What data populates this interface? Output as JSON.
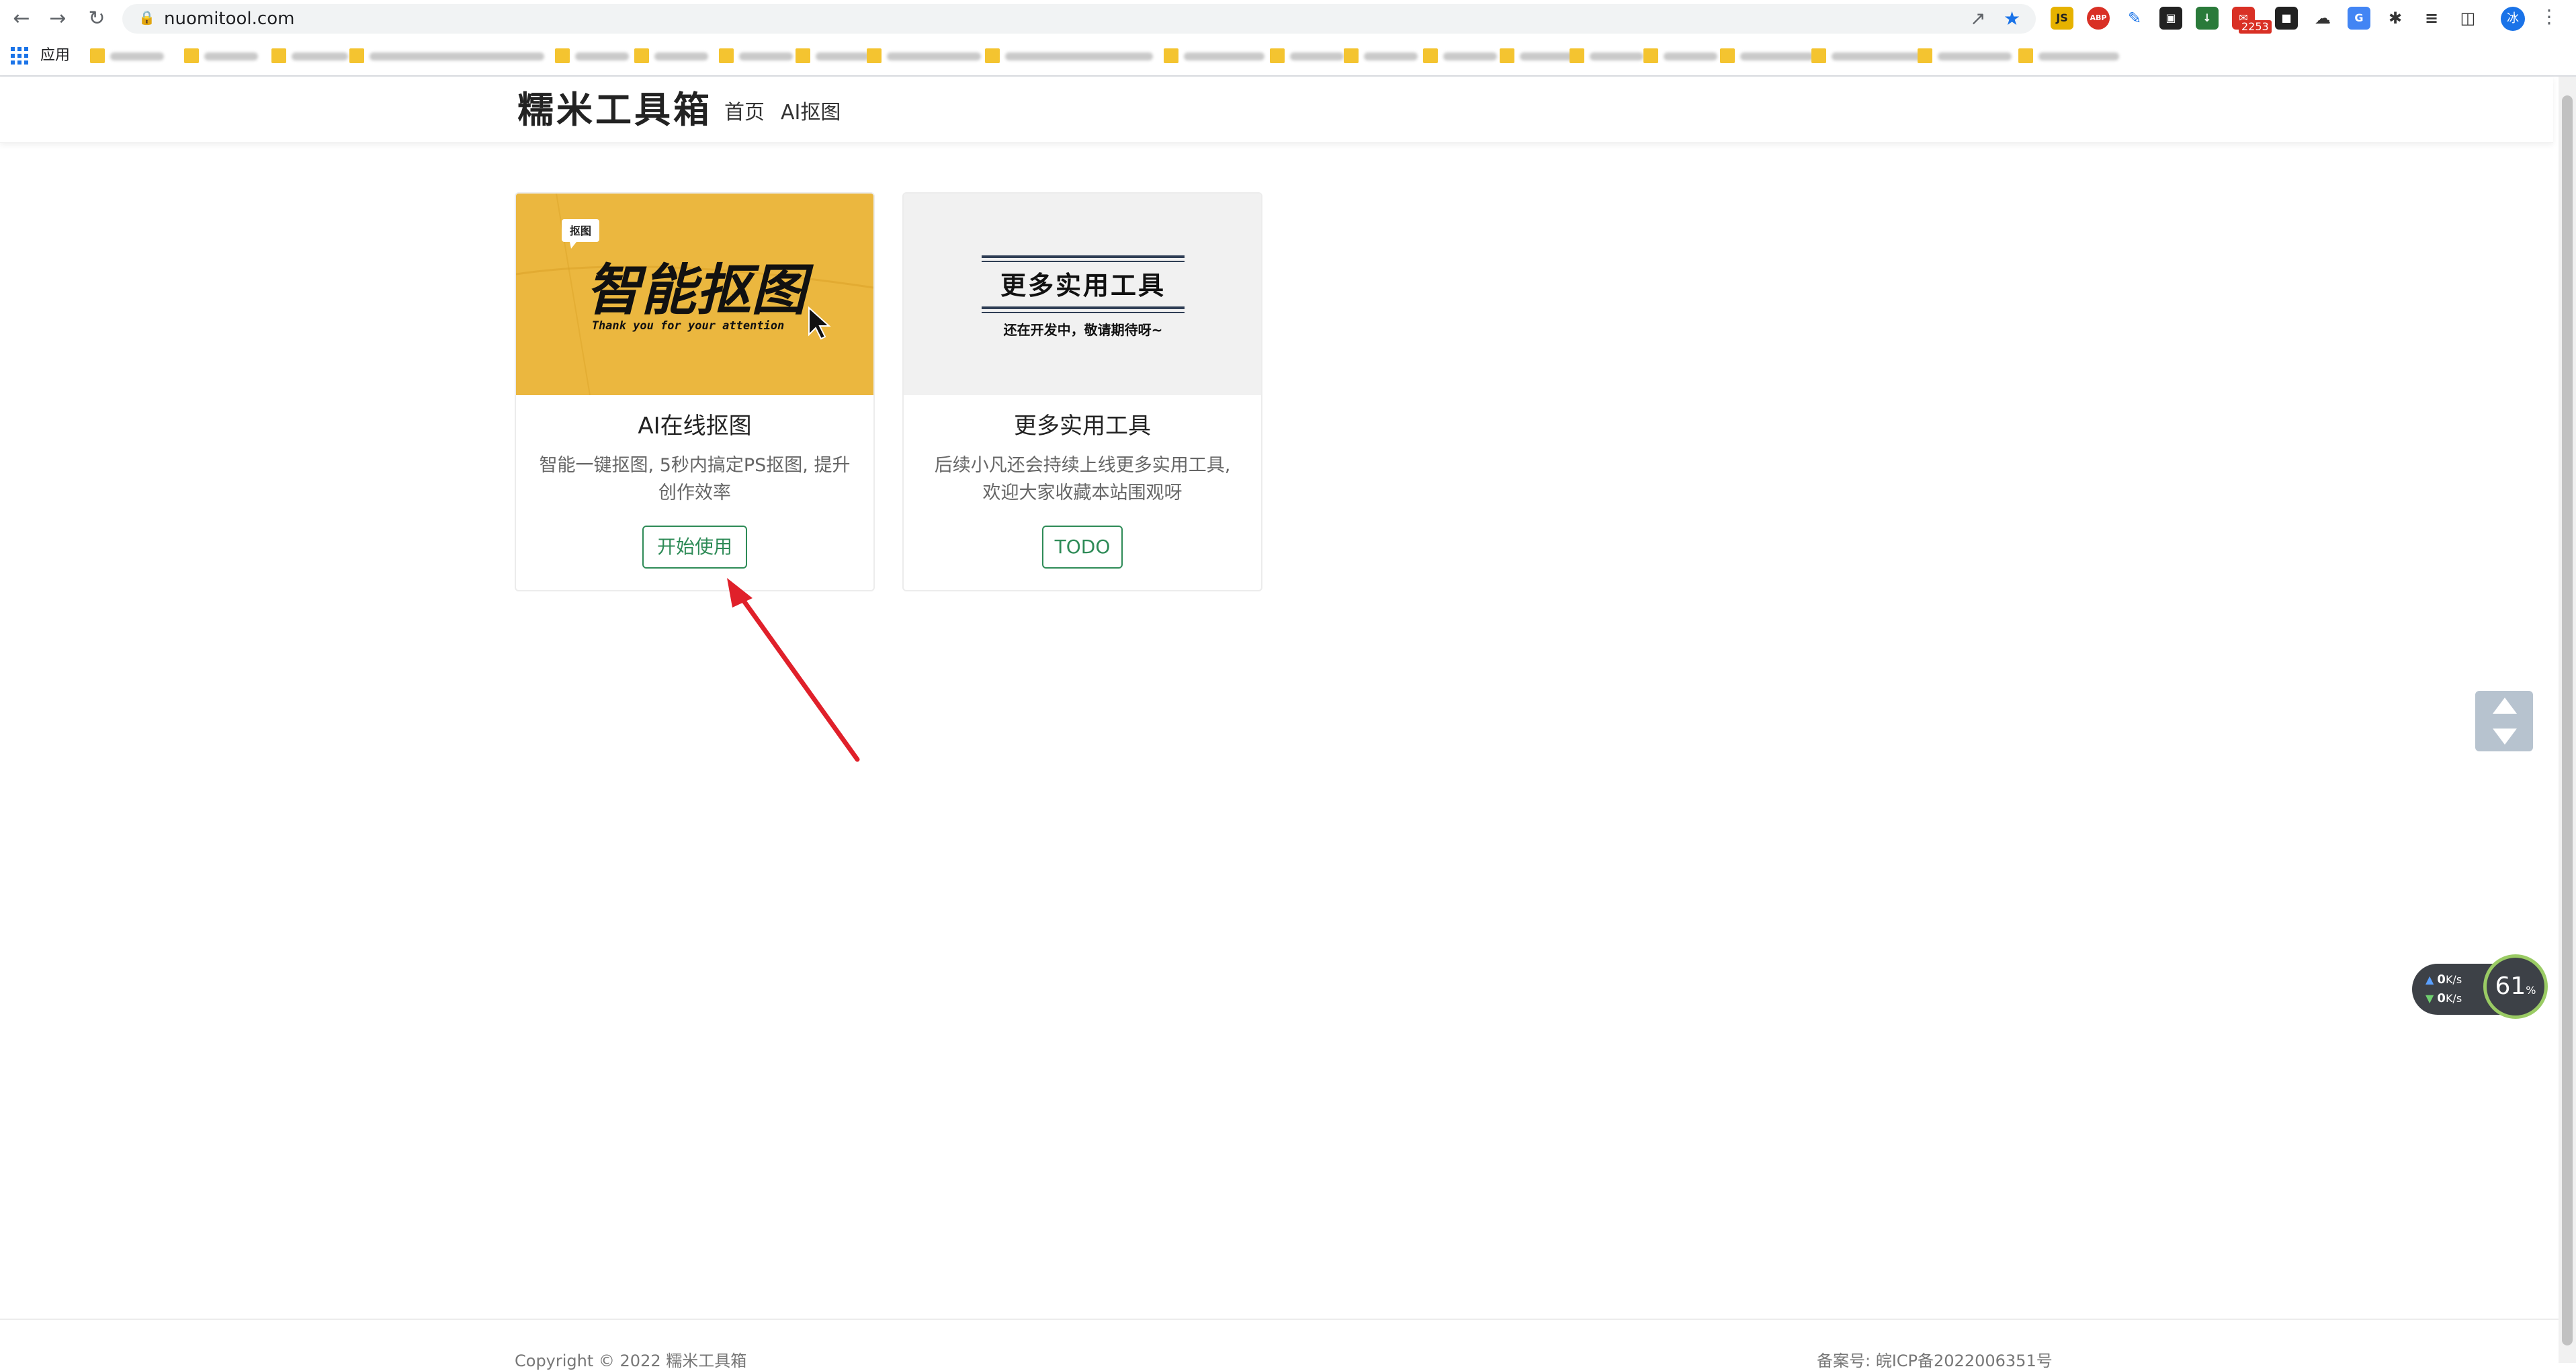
{
  "browser": {
    "url": "nuomitool.com",
    "apps_label": "应用",
    "extension_badge": "2253",
    "avatar_text": "冰"
  },
  "site": {
    "brand": "糯米工具箱",
    "nav": [
      "首页",
      "AI抠图"
    ]
  },
  "cards": [
    {
      "image_headline": "智能抠图",
      "image_sub": "Thank you for your attention",
      "image_tag": "抠图",
      "title": "AI在线抠图",
      "desc": "智能一键抠图, 5秒内搞定PS抠图, 提升创作效率",
      "button": "开始使用"
    },
    {
      "image_headline": "更多实用工具",
      "image_sub": "还在开发中，敬请期待呀~",
      "title": "更多实用工具",
      "desc": "后续小凡还会持续上线更多实用工具, 欢迎大家收藏本站围观呀",
      "button": "TODO"
    }
  ],
  "net_monitor": {
    "upload": "0",
    "download": "0",
    "unit": "K/s",
    "percent": "61",
    "percent_sign": "%"
  },
  "footer": {
    "left": "Copyright © 2022 糯米工具箱",
    "right": "备案号: 皖ICP备2022006351号"
  },
  "colors": {
    "button_green": "#2e8b57",
    "card1_bg": "#e8b23a",
    "arrow_red": "#e0202a"
  }
}
